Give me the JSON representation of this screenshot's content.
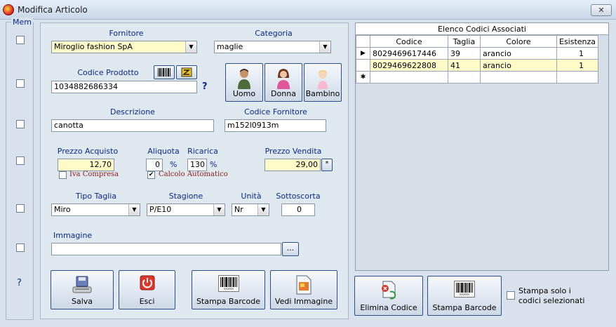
{
  "window": {
    "title": "Modifica Articolo",
    "close_symbol": "✕"
  },
  "mem": {
    "label": "Mem",
    "help": "?"
  },
  "form": {
    "fornitore_label": "Fornitore",
    "fornitore_value": "Miroglio fashion SpA",
    "categoria_label": "Categoria",
    "categoria_value": "maglie",
    "codice_prodotto_label": "Codice Prodotto",
    "codice_prodotto_value": "1034882686334",
    "codice_help": "?",
    "descrizione_label": "Descrizione",
    "descrizione_value": "canotta",
    "codice_fornitore_label": "Codice Fornitore",
    "codice_fornitore_value": "m152l0913m",
    "prezzo_acquisto_label": "Prezzo Acquisto",
    "prezzo_acquisto_value": "12,70",
    "aliquota_label": "Aliquota",
    "aliquota_value": "0",
    "percent1": "%",
    "ricarica_label": "Ricarica",
    "ricarica_value": "130",
    "percent2": "%",
    "prezzo_vendita_label": "Prezzo Vendita",
    "prezzo_vendita_value": "29,00",
    "iva_compresa_label": "Iva Compresa",
    "calcolo_automatico_label": "Calcolo Automatico",
    "calcolo_check": "✔",
    "tipo_taglia_label": "Tipo Taglia",
    "tipo_taglia_value": "Miro",
    "stagione_label": "Stagione",
    "stagione_value": "P/E10",
    "unita_label": "Unità",
    "unita_value": "Nr",
    "sottoscorta_label": "Sottoscorta",
    "sottoscorta_value": "0",
    "immagine_label": "Immagine",
    "immagine_value": "",
    "browse_label": "...",
    "star_label": "*"
  },
  "gender_buttons": {
    "uomo": "Uomo",
    "donna": "Donna",
    "bambino": "Bambino"
  },
  "action_buttons": {
    "salva": "Salva",
    "esci": "Esci",
    "stampa_barcode": "Stampa Barcode",
    "vedi_immagine": "Vedi Immagine",
    "elimina_codice": "Elimina Codice",
    "stampa_barcode_right": "Stampa Barcode"
  },
  "stampa_solo_label_1": "Stampa solo i",
  "stampa_solo_label_2": "codici selezionati",
  "grid": {
    "caption": "Elenco Codici Associati",
    "columns": [
      "Codice",
      "Taglia",
      "Colore",
      "Esistenza"
    ],
    "rows": [
      {
        "marker": "▶",
        "codice": "8029469617446",
        "taglia": "39",
        "colore": "arancio",
        "esistenza": "1"
      },
      {
        "marker": "",
        "codice": "8029469622808",
        "taglia": "41",
        "colore": "arancio",
        "esistenza": "1"
      }
    ],
    "new_row_marker": "✱"
  },
  "colors": {
    "label_blue": "#0b2a8c",
    "highlight_yellow": "#fffbc8",
    "red_text": "#8b1c1c"
  }
}
